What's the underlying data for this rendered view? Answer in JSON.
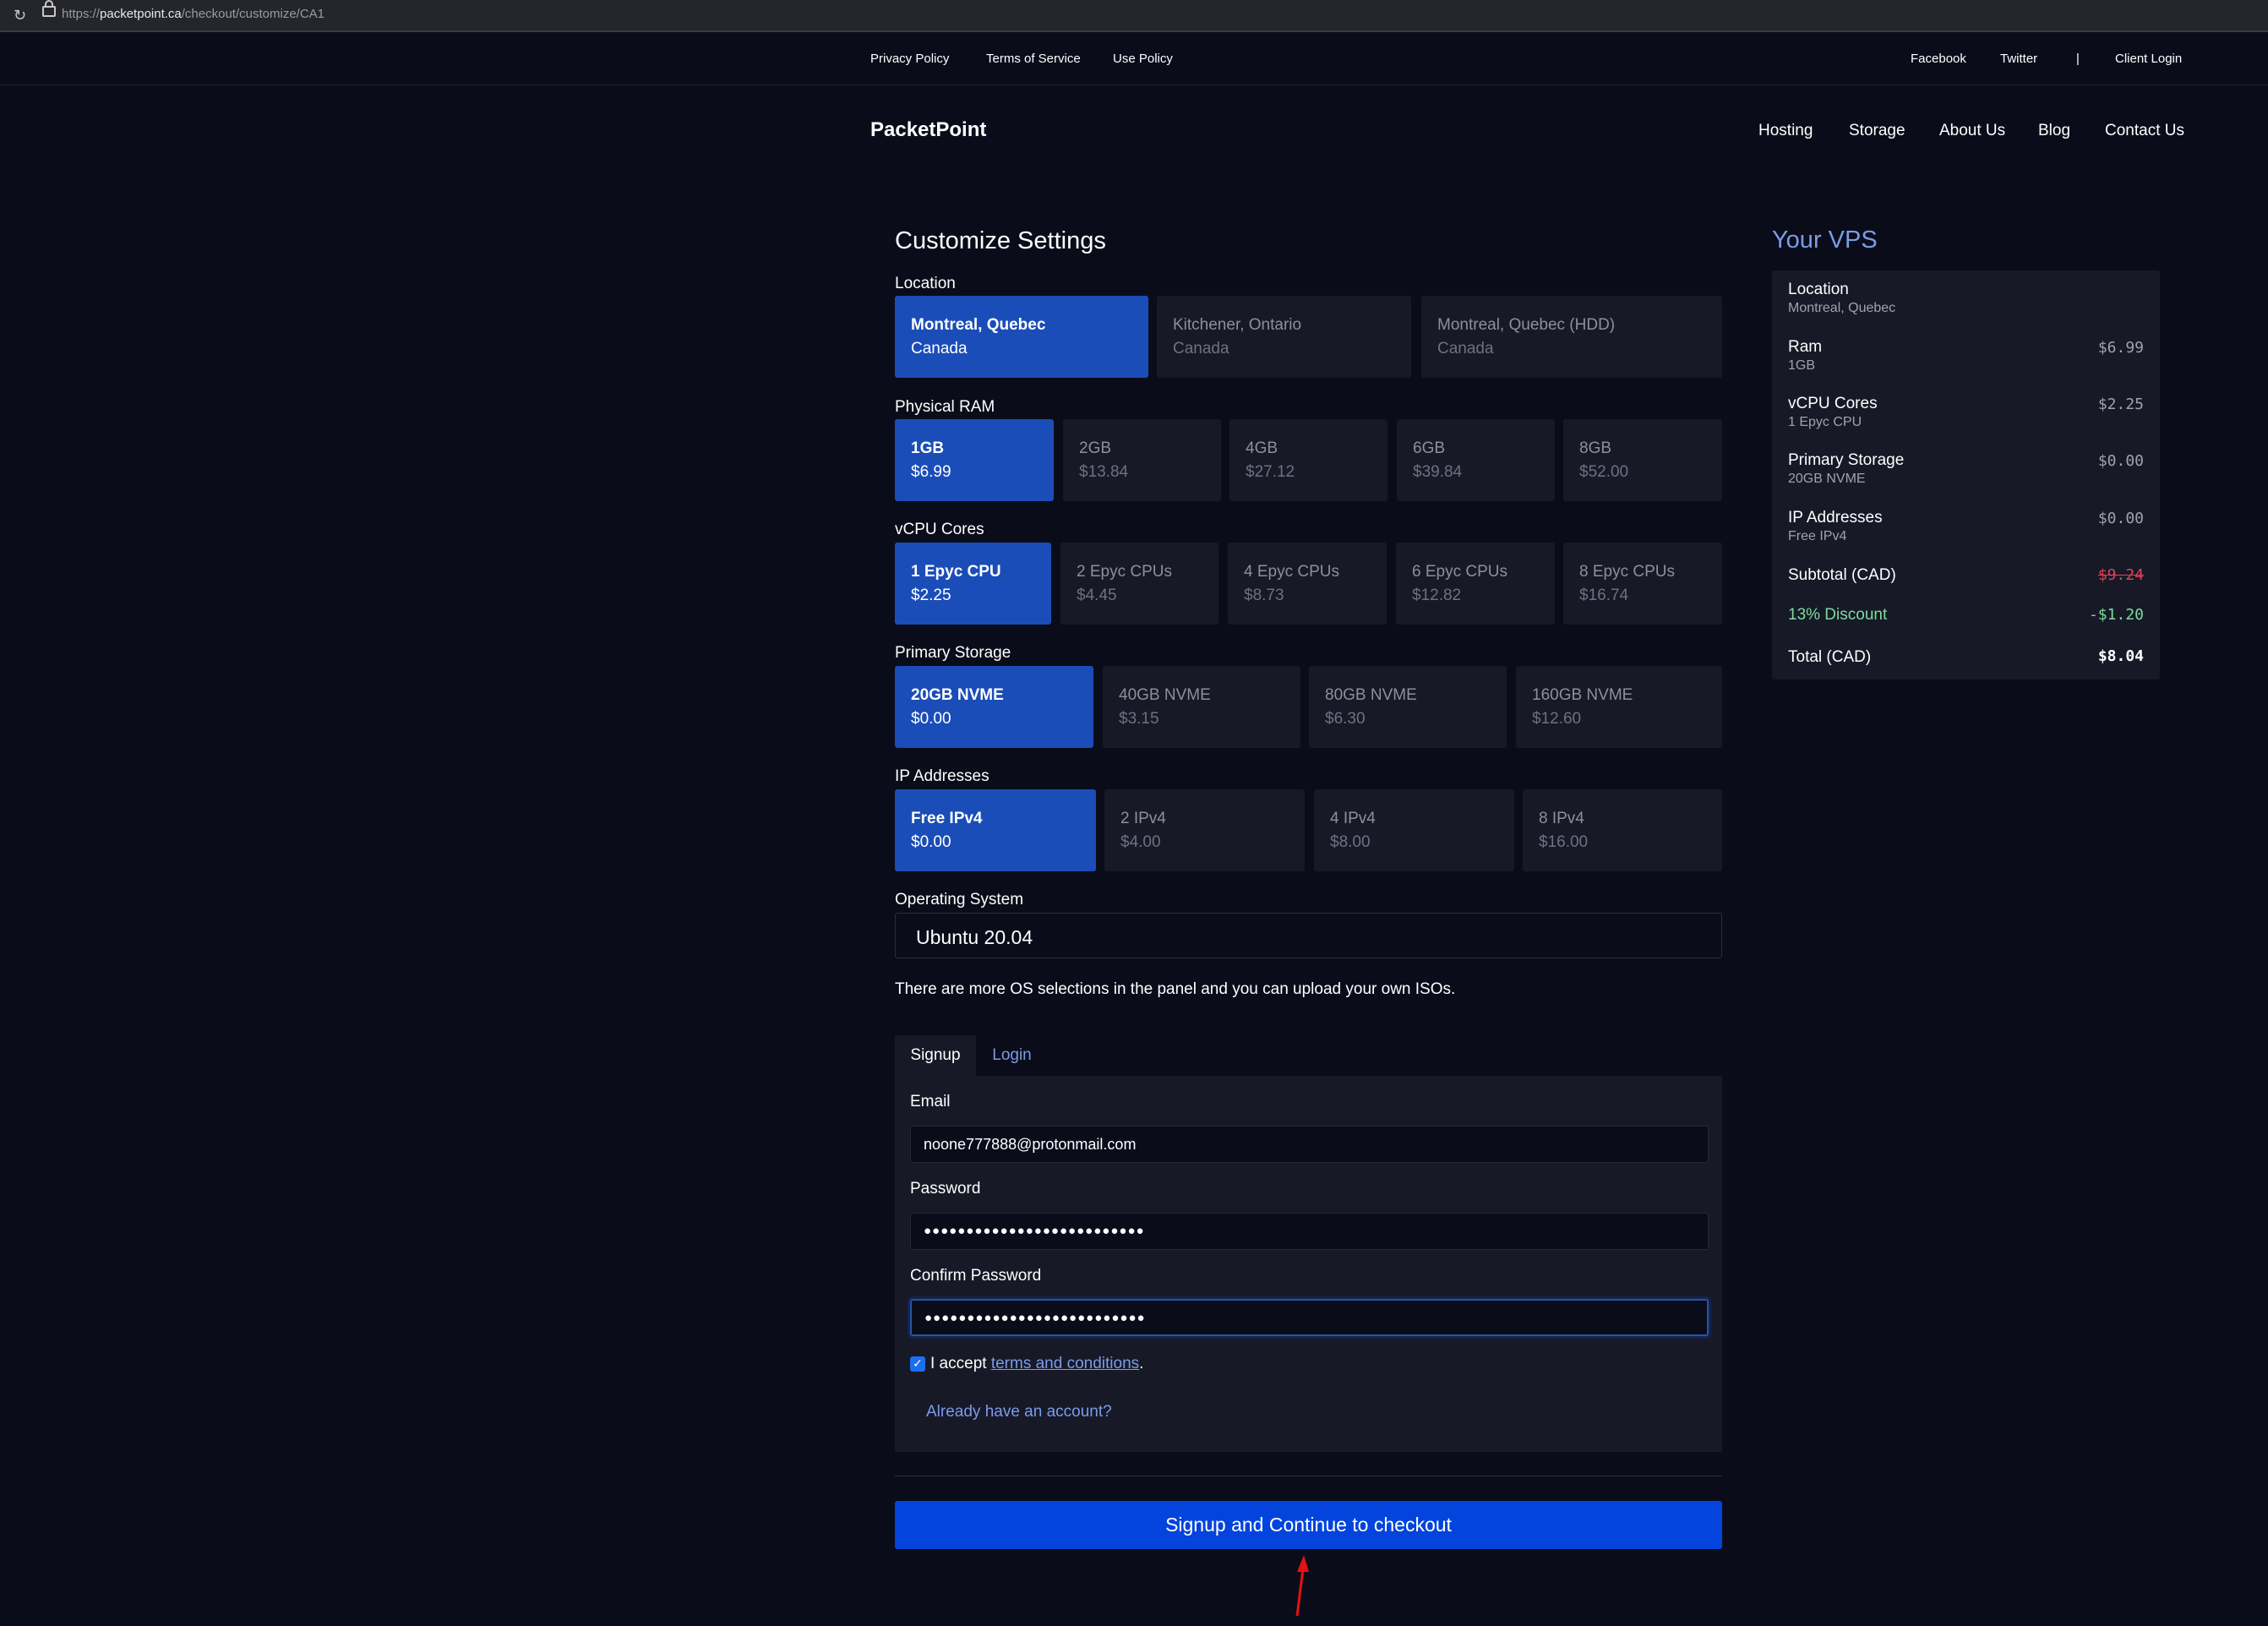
{
  "browser": {
    "url_prefix": "https://",
    "url_domain": "packetpoint.ca",
    "url_path": "/checkout/customize/CA1"
  },
  "topbar": {
    "links": [
      "Privacy Policy",
      "Terms of Service",
      "Use Policy"
    ],
    "social": [
      "Facebook",
      "Twitter"
    ],
    "separator": "|",
    "client_login": "Client Login"
  },
  "nav": {
    "brand": "PacketPoint",
    "items": [
      "Hosting",
      "Storage",
      "About Us",
      "Blog",
      "Contact Us"
    ]
  },
  "customize": {
    "title": "Customize Settings",
    "location": {
      "label": "Location",
      "options": [
        {
          "name": "Montreal, Quebec",
          "sub": "Canada",
          "selected": true
        },
        {
          "name": "Kitchener, Ontario",
          "sub": "Canada",
          "selected": false
        },
        {
          "name": "Montreal, Quebec (HDD)",
          "sub": "Canada",
          "selected": false
        }
      ]
    },
    "ram": {
      "label": "Physical RAM",
      "options": [
        {
          "name": "1GB",
          "price": "$6.99",
          "selected": true
        },
        {
          "name": "2GB",
          "price": "$13.84",
          "selected": false
        },
        {
          "name": "4GB",
          "price": "$27.12",
          "selected": false
        },
        {
          "name": "6GB",
          "price": "$39.84",
          "selected": false
        },
        {
          "name": "8GB",
          "price": "$52.00",
          "selected": false
        }
      ]
    },
    "cpu": {
      "label": "vCPU Cores",
      "options": [
        {
          "name": "1 Epyc CPU",
          "price": "$2.25",
          "selected": true
        },
        {
          "name": "2 Epyc CPUs",
          "price": "$4.45",
          "selected": false
        },
        {
          "name": "4 Epyc CPUs",
          "price": "$8.73",
          "selected": false
        },
        {
          "name": "6 Epyc CPUs",
          "price": "$12.82",
          "selected": false
        },
        {
          "name": "8 Epyc CPUs",
          "price": "$16.74",
          "selected": false
        }
      ]
    },
    "storage": {
      "label": "Primary Storage",
      "options": [
        {
          "name": "20GB NVME",
          "price": "$0.00",
          "selected": true
        },
        {
          "name": "40GB NVME",
          "price": "$3.15",
          "selected": false
        },
        {
          "name": "80GB NVME",
          "price": "$6.30",
          "selected": false
        },
        {
          "name": "160GB NVME",
          "price": "$12.60",
          "selected": false
        }
      ]
    },
    "ip": {
      "label": "IP Addresses",
      "options": [
        {
          "name": "Free IPv4",
          "price": "$0.00",
          "selected": true
        },
        {
          "name": "2 IPv4",
          "price": "$4.00",
          "selected": false
        },
        {
          "name": "4 IPv4",
          "price": "$8.00",
          "selected": false
        },
        {
          "name": "8 IPv4",
          "price": "$16.00",
          "selected": false
        }
      ]
    },
    "os": {
      "label": "Operating System",
      "value": "Ubuntu 20.04"
    },
    "os_note": "There are more OS selections in the panel and you can upload your own ISOs."
  },
  "auth": {
    "tabs": {
      "signup": "Signup",
      "login": "Login"
    },
    "email_label": "Email",
    "email_value": "noone777888@protonmail.com",
    "password_label": "Password",
    "password_value": "●●●●●●●●●●●●●●●●●●●●●●●●●●",
    "confirm_label": "Confirm Password",
    "confirm_value": "●●●●●●●●●●●●●●●●●●●●●●●●●●",
    "terms_checked": true,
    "accept_prefix": "I accept ",
    "terms_link": "terms and conditions",
    "accept_suffix": ".",
    "already": "Already have an account?",
    "submit": "Signup and Continue to checkout"
  },
  "summary": {
    "title": "Your VPS",
    "location_label": "Location",
    "location_value": "Montreal, Quebec",
    "ram_label": "Ram",
    "ram_value": "1GB",
    "ram_price": "$6.99",
    "cpu_label": "vCPU Cores",
    "cpu_value": "1 Epyc CPU",
    "cpu_price": "$2.25",
    "storage_label": "Primary Storage",
    "storage_value": "20GB NVME",
    "storage_price": "$0.00",
    "ip_label": "IP Addresses",
    "ip_value": "Free IPv4",
    "ip_price": "$0.00",
    "subtotal_label": "Subtotal (CAD)",
    "subtotal_price": "$9.24",
    "discount_label": "13% Discount",
    "discount_price": "-$1.20",
    "total_label": "Total (CAD)",
    "total_price": "$8.04"
  },
  "colors": {
    "accent": "#1a4db8",
    "cta": "#0344dc",
    "link": "#7a9ce8",
    "discount": "#7ddc9a",
    "strike": "#e0405a",
    "background": "#0b0c1a",
    "panel": "#171927"
  }
}
